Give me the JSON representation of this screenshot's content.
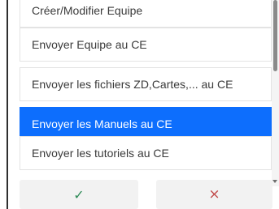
{
  "menu": {
    "items": [
      {
        "label": "Créer/Modifier Equipe",
        "selected": false
      },
      {
        "label": "Envoyer Equipe au CE",
        "selected": false
      },
      {
        "label": "Envoyer les fichiers ZD,Cartes,... au CE",
        "selected": false
      },
      {
        "label": "Envoyer les Manuels au CE",
        "selected": true
      },
      {
        "label": "Envoyer les tutoriels au CE",
        "selected": false
      }
    ]
  },
  "actions": {
    "confirm_icon": "✓",
    "cancel_icon": "×"
  },
  "colors": {
    "selected_bg": "#0d6efd",
    "confirm": "#2e8b57",
    "cancel": "#c04848"
  }
}
